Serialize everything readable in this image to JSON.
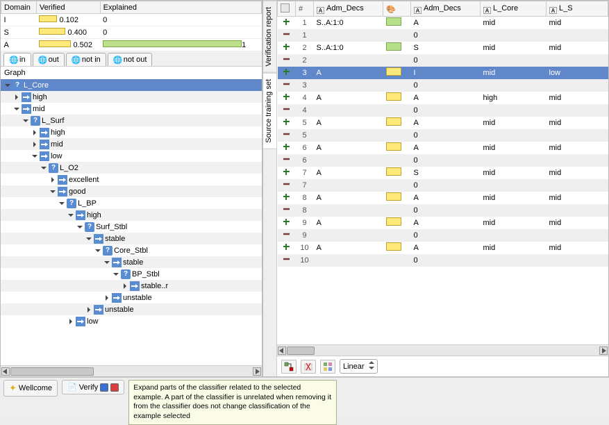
{
  "verified_table": {
    "headers": [
      "Domain",
      "Verified",
      "Explained"
    ],
    "rows": [
      {
        "domain": "I",
        "verified": "0.102",
        "explained": "0"
      },
      {
        "domain": "S",
        "verified": "0.400",
        "explained": "0"
      },
      {
        "domain": "A",
        "verified": "0.502",
        "explained": "1"
      }
    ]
  },
  "tabs": [
    {
      "label": "in",
      "active": true
    },
    {
      "label": "out",
      "active": false
    },
    {
      "label": "not in",
      "active": false
    },
    {
      "label": "not out",
      "active": false
    }
  ],
  "graph_label": "Graph",
  "tree": [
    {
      "indent": 0,
      "twist": "down",
      "type": "q",
      "label": "L_Core",
      "sel": true
    },
    {
      "indent": 1,
      "twist": "right",
      "type": "a",
      "label": "high"
    },
    {
      "indent": 1,
      "twist": "down",
      "type": "a",
      "label": "mid"
    },
    {
      "indent": 2,
      "twist": "down",
      "type": "q",
      "label": "L_Surf"
    },
    {
      "indent": 3,
      "twist": "right",
      "type": "a",
      "label": "high"
    },
    {
      "indent": 3,
      "twist": "right",
      "type": "a",
      "label": "mid"
    },
    {
      "indent": 3,
      "twist": "down",
      "type": "a",
      "label": "low"
    },
    {
      "indent": 4,
      "twist": "down",
      "type": "q",
      "label": "L_O2"
    },
    {
      "indent": 5,
      "twist": "right",
      "type": "a",
      "label": "excellent"
    },
    {
      "indent": 5,
      "twist": "down",
      "type": "a",
      "label": "good"
    },
    {
      "indent": 6,
      "twist": "down",
      "type": "q",
      "label": "L_BP"
    },
    {
      "indent": 7,
      "twist": "down",
      "type": "a",
      "label": "high"
    },
    {
      "indent": 8,
      "twist": "down",
      "type": "q",
      "label": "Surf_Stbl"
    },
    {
      "indent": 9,
      "twist": "down",
      "type": "a",
      "label": "stable"
    },
    {
      "indent": 10,
      "twist": "down",
      "type": "q",
      "label": "Core_Stbl"
    },
    {
      "indent": 11,
      "twist": "down",
      "type": "a",
      "label": "stable"
    },
    {
      "indent": 12,
      "twist": "down",
      "type": "q",
      "label": "BP_Stbl"
    },
    {
      "indent": 13,
      "twist": "right",
      "type": "a",
      "label": "stable..r"
    },
    {
      "indent": 11,
      "twist": "right",
      "type": "a",
      "label": "unstable"
    },
    {
      "indent": 9,
      "twist": "right",
      "type": "a",
      "label": "unstable"
    },
    {
      "indent": 7,
      "twist": "right",
      "type": "a",
      "label": "low"
    }
  ],
  "vtabs": [
    {
      "label": "Verification report",
      "active": false
    },
    {
      "label": "Source training set",
      "active": true
    }
  ],
  "data_headers": [
    "",
    "#",
    "Adm_Decs",
    "",
    "Adm_Decs",
    "L_Core",
    "L_S"
  ],
  "data_rows": [
    {
      "n": "1",
      "ic": "plus",
      "c1": "S..A:1:0",
      "bar": "g",
      "c2": "A",
      "c3": "mid",
      "c4": "mid"
    },
    {
      "n": "1",
      "ic": "minus",
      "c1": "",
      "bar": "",
      "c2": "0",
      "c3": "",
      "c4": ""
    },
    {
      "n": "2",
      "ic": "plus",
      "c1": "S..A:1:0",
      "bar": "g",
      "c2": "S",
      "c3": "mid",
      "c4": "mid"
    },
    {
      "n": "2",
      "ic": "minus",
      "c1": "",
      "bar": "",
      "c2": "0",
      "c3": "",
      "c4": ""
    },
    {
      "n": "3",
      "ic": "plus",
      "c1": "A",
      "bar": "y",
      "c2": "I",
      "c3": "mid",
      "c4": "low",
      "sel": true
    },
    {
      "n": "3",
      "ic": "minus",
      "c1": "",
      "bar": "",
      "c2": "0",
      "c3": "",
      "c4": ""
    },
    {
      "n": "4",
      "ic": "plus",
      "c1": "A",
      "bar": "y",
      "c2": "A",
      "c3": "high",
      "c4": "mid"
    },
    {
      "n": "4",
      "ic": "minus",
      "c1": "",
      "bar": "",
      "c2": "0",
      "c3": "",
      "c4": ""
    },
    {
      "n": "5",
      "ic": "plus",
      "c1": "A",
      "bar": "y",
      "c2": "A",
      "c3": "mid",
      "c4": "mid"
    },
    {
      "n": "5",
      "ic": "minus",
      "c1": "",
      "bar": "",
      "c2": "0",
      "c3": "",
      "c4": ""
    },
    {
      "n": "6",
      "ic": "plus",
      "c1": "A",
      "bar": "y",
      "c2": "A",
      "c3": "mid",
      "c4": "mid"
    },
    {
      "n": "6",
      "ic": "minus",
      "c1": "",
      "bar": "",
      "c2": "0",
      "c3": "",
      "c4": ""
    },
    {
      "n": "7",
      "ic": "plus",
      "c1": "A",
      "bar": "y",
      "c2": "S",
      "c3": "mid",
      "c4": "mid"
    },
    {
      "n": "7",
      "ic": "minus",
      "c1": "",
      "bar": "",
      "c2": "0",
      "c3": "",
      "c4": ""
    },
    {
      "n": "8",
      "ic": "plus",
      "c1": "A",
      "bar": "y",
      "c2": "A",
      "c3": "mid",
      "c4": "mid"
    },
    {
      "n": "8",
      "ic": "minus",
      "c1": "",
      "bar": "",
      "c2": "0",
      "c3": "",
      "c4": ""
    },
    {
      "n": "9",
      "ic": "plus",
      "c1": "A",
      "bar": "y",
      "c2": "A",
      "c3": "mid",
      "c4": "mid"
    },
    {
      "n": "9",
      "ic": "minus",
      "c1": "",
      "bar": "",
      "c2": "0",
      "c3": "",
      "c4": ""
    },
    {
      "n": "10",
      "ic": "plus",
      "c1": "A",
      "bar": "y",
      "c2": "A",
      "c3": "mid",
      "c4": "mid"
    },
    {
      "n": "10",
      "ic": "minus",
      "c1": "",
      "bar": "",
      "c2": "0",
      "c3": "",
      "c4": ""
    }
  ],
  "select_label": "Linear",
  "bottom": {
    "wellcome": "Wellcome",
    "verify": "Verify",
    "tooltip": "Expand parts of the classifier related to the selected example. A part of the classifier is unrelated when removing it from the classifier does not change classification of the example selected"
  }
}
